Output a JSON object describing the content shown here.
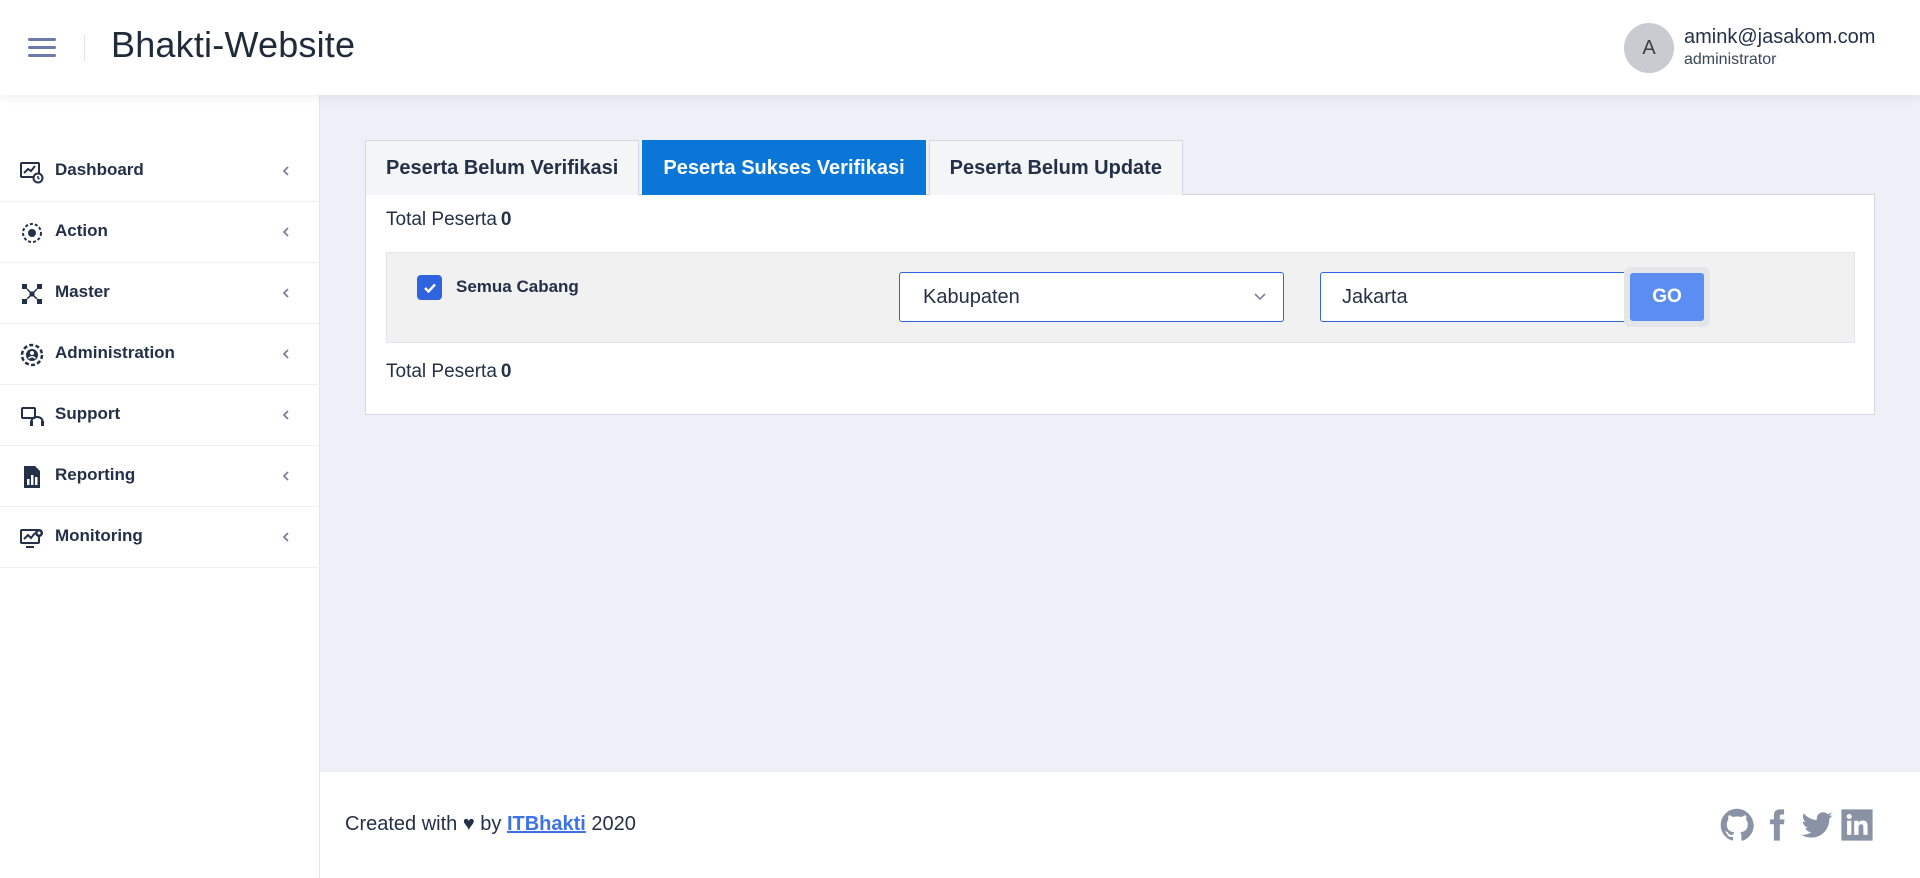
{
  "header": {
    "title": "Bhakti-Website",
    "avatar_letter": "A",
    "user_email": "amink@jasakom.com",
    "user_role": "administrator"
  },
  "sidebar": {
    "items": [
      {
        "label": "Dashboard",
        "icon": "dashboard-icon"
      },
      {
        "label": "Action",
        "icon": "action-icon"
      },
      {
        "label": "Master",
        "icon": "master-icon"
      },
      {
        "label": "Administration",
        "icon": "administration-icon"
      },
      {
        "label": "Support",
        "icon": "support-icon"
      },
      {
        "label": "Reporting",
        "icon": "reporting-icon"
      },
      {
        "label": "Monitoring",
        "icon": "monitoring-icon"
      }
    ]
  },
  "tabs": [
    {
      "label": "Peserta Belum Verifikasi",
      "active": false
    },
    {
      "label": "Peserta Sukses Verifikasi",
      "active": true
    },
    {
      "label": "Peserta Belum Update",
      "active": false
    }
  ],
  "panel": {
    "total_label": "Total Peserta",
    "total_value_top": "0",
    "total_value_bottom": "0",
    "filter": {
      "checkbox_label": "Semua Cabang",
      "checkbox_checked": true,
      "select_value": "Kabupaten",
      "input_value": "Jakarta",
      "go_label": "GO"
    }
  },
  "footer": {
    "prefix": "Created with ♥ by",
    "link_text": "ITBhakti",
    "year": "2020",
    "social": [
      "github-icon",
      "facebook-icon",
      "twitter-icon",
      "linkedin-icon"
    ]
  },
  "colors": {
    "accent": "#0a76d8",
    "checkbox": "#2f63e0",
    "go_button": "#5b8df2",
    "link": "#3d73e6"
  }
}
